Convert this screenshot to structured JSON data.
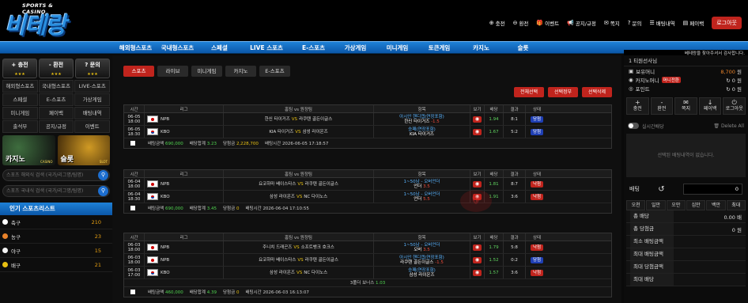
{
  "logo": {
    "sub": "SPORTS & CASINO",
    "main": "비테랑"
  },
  "user_nav": [
    {
      "icon": "plus-icon",
      "label": "충전"
    },
    {
      "icon": "minus-icon",
      "label": "환전"
    },
    {
      "icon": "gift-icon",
      "label": "이벤트"
    },
    {
      "icon": "bell-icon",
      "label": "공지/규정"
    },
    {
      "icon": "mail-icon",
      "label": "쪽지"
    },
    {
      "icon": "question-icon",
      "label": "문의"
    },
    {
      "icon": "list-icon",
      "label": "배팅내역"
    },
    {
      "icon": "card-icon",
      "label": "페이백"
    }
  ],
  "logout_label": "로그아웃",
  "main_nav": [
    "해외형스포츠",
    "국내형스포츠",
    "스페셜",
    "LIVE 스포츠",
    "E-스포츠",
    "가상게임",
    "미니게임",
    "토큰게임",
    "카지노",
    "슬롯"
  ],
  "marquee": "베테랑을 찾아주셔서 감사합니다.",
  "sidebar": {
    "top_buttons": [
      {
        "label": "+ 충전"
      },
      {
        "label": "- 환전"
      },
      {
        "label": "? 문의"
      }
    ],
    "grid": [
      "해외형스포츠",
      "국내형스포츠",
      "LIVE-스포츠",
      "스페셜",
      "E-스포츠",
      "가상게임",
      "미니게임",
      "페이백",
      "배팅내역",
      "출석부",
      "공지/규정",
      "이벤트"
    ],
    "banners": [
      {
        "label": "카지노",
        "sub": "CASINO"
      },
      {
        "label": "슬롯",
        "sub": "SLOT"
      }
    ],
    "search1_placeholder": "스포츠 해외식 검색 (국가/리그명/팀명)",
    "search2_placeholder": "스포츠 국내식 검색 (국가/리그명/팀명)",
    "popular_title": "인기 스포츠리스트",
    "sports": [
      {
        "name": "축구",
        "count": "210",
        "color": "#ffffff"
      },
      {
        "name": "농구",
        "count": "23",
        "color": "#e8822a"
      },
      {
        "name": "야구",
        "count": "15",
        "color": "#f2f2f2"
      },
      {
        "name": "배구",
        "count": "21",
        "color": "#e8c012"
      }
    ]
  },
  "tabs": [
    "스포츠",
    "라이브",
    "미니게임",
    "카지노",
    "E-스포츠"
  ],
  "actions": [
    "전체선택",
    "선택정부",
    "선택삭제"
  ],
  "headers": {
    "time": "시간",
    "league": "리그",
    "match": "홈팀 vs 원정팀",
    "pick": "항목",
    "view": "보기",
    "odds": "배당",
    "result": "결과",
    "status": "상태"
  },
  "slips": [
    {
      "rows": [
        {
          "date": "06-05",
          "time": "18:00",
          "flag": "jp",
          "league": "NPB",
          "home": "한신 타이거즈",
          "away": "라쿠텐 골든이글스",
          "pick1": "아시안 핸디캡(연장포함)",
          "pick2": "한신 타이거즈",
          "pick_num": "-1.5",
          "odds": "1.94",
          "result": "8:1",
          "status": "당첨",
          "st": "b"
        },
        {
          "date": "06-05",
          "time": "18:30",
          "flag": "kr",
          "league": "KBO",
          "home": "KIA 타이거즈",
          "away": "삼성 라이온즈",
          "pick1": "승패(연장포함)",
          "pick2": "KIA 타이거즈",
          "pick_num": "",
          "odds": "1.67",
          "result": "5:2",
          "status": "당첨",
          "st": "b"
        }
      ],
      "foot": {
        "amount_label": "배팅금액",
        "amount": "690,000",
        "sum_label": "배당합계",
        "sum": "3.23",
        "win_label": "당첨금",
        "win": "2,228,700",
        "time_label": "배팅시간",
        "time": "2026-06-05 17:18:57"
      }
    },
    {
      "rows": [
        {
          "date": "06-04",
          "time": "18:00",
          "flag": "jp",
          "league": "NPB",
          "home": "요코하마 베이스타스",
          "away": "라쿠텐 골든이글스",
          "pick1": "1~50남 - 오버언더",
          "pick2": "언더",
          "pick_num": "3.5",
          "odds": "1.81",
          "result": "8:7",
          "status": "낙첨",
          "st": "r"
        },
        {
          "date": "06-04",
          "time": "18:30",
          "flag": "kr",
          "league": "KBO",
          "home": "삼성 라이온즈",
          "away": "NC 다이노스",
          "pick1": "1~50남 - 오버언더",
          "pick2": "언더",
          "pick_num": "5.5",
          "odds": "1.91",
          "result": "3:6",
          "status": "낙첨",
          "st": "r"
        }
      ],
      "foot": {
        "amount_label": "배팅금액",
        "amount": "690,000",
        "sum_label": "배당합계",
        "sum": "3.45",
        "win_label": "당첨금",
        "win": "0",
        "time_label": "배팅시간",
        "time": "2026-06-04 17:10:55"
      }
    },
    {
      "rows": [
        {
          "date": "06-03",
          "time": "18:00",
          "flag": "jp",
          "league": "NPB",
          "home": "주니치 드래곤즈",
          "away": "소프트뱅크 호크스",
          "pick1": "1~50남 - 오버언더",
          "pick2": "오버",
          "pick_num": "3.5",
          "odds": "1.79",
          "result": "5:8",
          "status": "낙첨",
          "st": "r"
        },
        {
          "date": "06-03",
          "time": "18:00",
          "flag": "jp",
          "league": "NPB",
          "home": "요코하마 베이스타스",
          "away": "라쿠텐 골든이글스",
          "pick1": "아시안 핸디캡(연장포함)",
          "pick2": "라쿠텐 골든이글스",
          "pick_num": "-1.5",
          "odds": "1.52",
          "result": "0:2",
          "status": "당첨",
          "st": "b"
        },
        {
          "date": "06-03",
          "time": "17:00",
          "flag": "kr",
          "league": "KBO",
          "home": "삼성 라이온즈",
          "away": "NC 다이노스",
          "pick1": "승패(연장포함)",
          "pick2": "삼성 라이온즈",
          "pick_num": "",
          "odds": "1.57",
          "result": "3:6",
          "status": "낙첨",
          "st": "r"
        }
      ],
      "bonus_label": "3폴더 보너스",
      "bonus_val": "1.03",
      "foot": {
        "amount_label": "배팅금액",
        "amount": "460,000",
        "sum_label": "배당합계",
        "sum": "4.39",
        "win_label": "당첨금",
        "win": "0",
        "time_label": "배팅시간",
        "time": "2026-06-03 16:13:07"
      }
    }
  ],
  "vs": "VS",
  "right": {
    "user": "1 티원선사님",
    "money_label": "보유머니",
    "money": "8,700",
    "money_unit": "원",
    "casino_label": "카지노머니",
    "casino_tag": "머니전환",
    "casino": "0",
    "casino_unit": "원",
    "point_label": "포인트",
    "point": "0",
    "point_unit": "원",
    "icons": [
      {
        "g": "+",
        "label": "충전"
      },
      {
        "g": "-",
        "label": "환전"
      },
      {
        "g": "✉",
        "label": "쪽지"
      },
      {
        "g": "↓",
        "label": "페이백"
      },
      {
        "g": "⏻",
        "label": "로그아웃"
      }
    ],
    "live_label": "실시간배당",
    "delete_all": "Delete All",
    "slip_empty": "선택된 배팅내역이 없습니다.",
    "bet_label": "배팅",
    "bet_value": "0",
    "amounts": [
      "오천",
      "일만",
      "오만",
      "십만",
      "백만",
      "최대"
    ],
    "summary": [
      {
        "label": "총 배당",
        "value": "0.00",
        "unit": "배"
      },
      {
        "label": "총 당첨금",
        "value": "0",
        "unit": "원"
      },
      {
        "label": "최소 배팅금액",
        "value": "",
        "unit": ""
      },
      {
        "label": "최대 배팅금액",
        "value": "",
        "unit": ""
      },
      {
        "label": "최대 당첨금액",
        "value": "",
        "unit": ""
      },
      {
        "label": "최대 배당",
        "value": "",
        "unit": ""
      }
    ]
  },
  "colors": {
    "accent": "#c0241d",
    "nav": "#1066c0",
    "highlight": "#e8c012"
  }
}
